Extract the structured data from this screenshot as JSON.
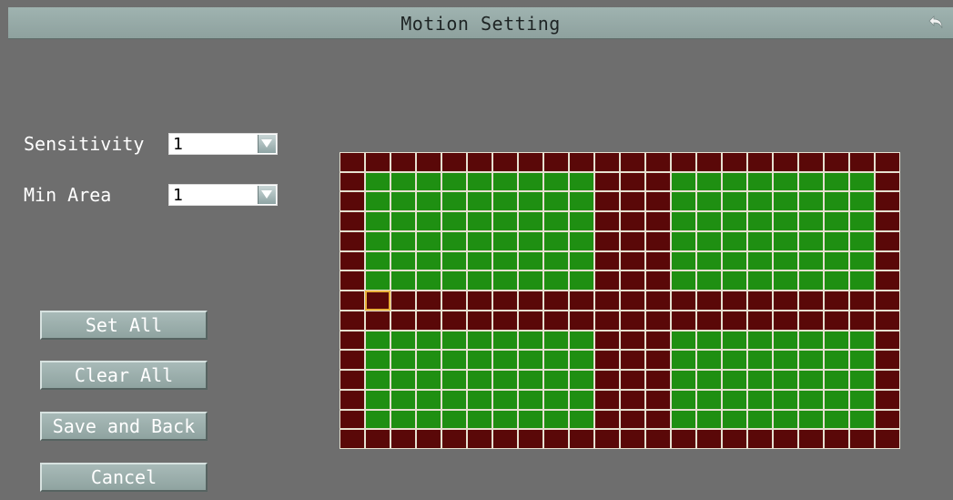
{
  "window": {
    "title": "Motion Setting",
    "back_icon": "back-arrow-icon"
  },
  "settings": {
    "sensitivity": {
      "label": "Sensitivity",
      "value": "1"
    },
    "min_area": {
      "label": "Min Area",
      "value": "1"
    }
  },
  "buttons": {
    "set_all": "Set All",
    "clear_all": "Clear All",
    "save_and_back": "Save and Back",
    "cancel": "Cancel"
  },
  "motion_grid": {
    "columns": 22,
    "rows": 15,
    "enabled_color": "#1f8f12",
    "disabled_color": "#5a0808",
    "cursor_color": "#e9b23a",
    "cursor_cell": {
      "row": 7,
      "col": 1
    },
    "cells": [
      "0000000000000000000000",
      "0111111111000111111110",
      "0111111111000111111110",
      "0111111111000111111110",
      "0111111111000111111110",
      "0111111111000111111110",
      "0111111111000111111110",
      "0000000000000000000000",
      "0000000000000000000000",
      "0111111111000111111110",
      "0111111111000111111110",
      "0111111111000111111110",
      "0111111111000111111110",
      "0111111111000111111110",
      "0000000000000000000000"
    ]
  }
}
